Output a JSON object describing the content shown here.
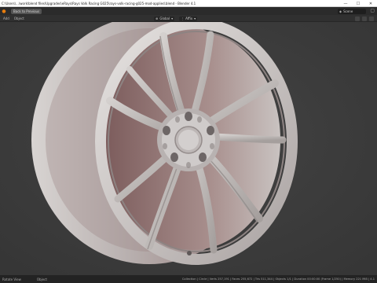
{
  "window": {
    "title": "C:\\Users\\...\\work\\blend files\\Upgrades\\eRays\\Rays Volk Racing G025\\rays-volk-racing-g025-mod-applied.blend - Blender 4.1",
    "minimize": "—",
    "maximize": "☐",
    "close": "✕"
  },
  "topbar": {
    "back_label": "Back to Previous",
    "scene_label": "Scene"
  },
  "header": {
    "mode_label": "Add",
    "object_label": "Object",
    "shading_label": "Global",
    "snap_label": "Affix"
  },
  "status": {
    "left_label": "Rotate View",
    "right_label": "Object",
    "stats": "Collection | Circle | Verts 257,191 | Faces 255,672 | Tris 511,344 | Objects 1/1 | Duration 00:00:00 (Frame 1/250) | Memory 221 MiB | 4.1"
  },
  "colors": {
    "viewport_bg": "#3d3d3d",
    "accent": "#e87d0d",
    "rim_light": "#c8c5c3",
    "rim_shadow": "#7a5c5c"
  }
}
